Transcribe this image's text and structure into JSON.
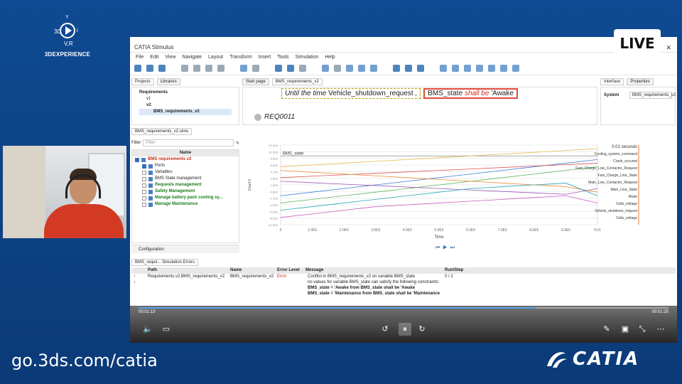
{
  "brand": {
    "name": "3DEXPERIENCE",
    "logo_text": "3D V,R"
  },
  "footer": {
    "url": "go.3ds.com/catia",
    "logo_word": "CATIA"
  },
  "live_badge": "LIVE",
  "app": {
    "title": "CATIA Stimulus",
    "menu": [
      "File",
      "Edit",
      "View",
      "Navigate",
      "Layout",
      "Transform",
      "Insert",
      "Tools",
      "Simulation",
      "Help"
    ]
  },
  "projects": {
    "tabs": [
      "Projects",
      "Libraries"
    ],
    "tree": [
      "Requirements",
      "v1",
      "v2",
      "BMS_requirements_v2"
    ]
  },
  "editor": {
    "tabs": [
      "Start page",
      "BMS_requirements_v2"
    ],
    "until_text": "Until the time",
    "until_var": "Vehicle_shutdown_request",
    "comma": ",",
    "state_var": "BMS_state",
    "shall_be": "shall be",
    "state_val": "'Awake",
    "req_id": "REQ0011"
  },
  "interface_panel": {
    "tabs": [
      "Interface",
      "Properties"
    ],
    "system_label": "System",
    "system_value": "BMS_requirements_v2"
  },
  "simulation": {
    "tab": "BMS_requirements_v2.simu",
    "filter_label": "Filter",
    "filter_placeholder": "Filter",
    "col_name": "Name",
    "rows": [
      {
        "label": "BMS requirements v2",
        "style": "redt"
      },
      {
        "label": "Ports",
        "style": ""
      },
      {
        "label": "Variables",
        "style": ""
      },
      {
        "label": "BMS State management",
        "style": ""
      },
      {
        "label": "Requests management",
        "style": "green"
      },
      {
        "label": "Safety Management",
        "style": "green"
      },
      {
        "label": "Manage battery pack cooling sy...",
        "style": "green"
      },
      {
        "label": "Manage Maintenance",
        "style": "green"
      }
    ],
    "configuration": "Configuration"
  },
  "chart_data": {
    "type": "line",
    "title": "",
    "xlabel": "Time",
    "ylabel": "Chart 0",
    "x_ticks": [
      "0",
      "1.0E5",
      "2.0E5",
      "3.0E5",
      "4.0E5",
      "5.0E5",
      "6.0E5",
      "7.0E5",
      "8.0E5",
      "9.0E5",
      "0.01"
    ],
    "time_readout": "0.01 seconds",
    "series": [
      {
        "name": "BMS_state",
        "values": [
          9,
          9,
          9,
          9,
          9,
          9,
          9,
          9,
          9,
          9,
          9
        ],
        "color": "#888888"
      },
      {
        "name": "Cooling_system_command",
        "values": [
          6,
          6.5,
          7,
          7.5,
          8,
          8.5,
          9,
          9.5,
          10,
          10.5,
          11
        ],
        "color": "#e8b84a"
      },
      {
        "name": "Crash_occured",
        "values": [
          -2,
          -1,
          0,
          1,
          2,
          3,
          4,
          5,
          6,
          7,
          8
        ],
        "color": "#3b7fd0"
      },
      {
        "name": "Fast_Charge_Low_Contactor_Request",
        "values": [
          3,
          3.4,
          3.8,
          4.2,
          4.6,
          5,
          5.4,
          5.8,
          6.2,
          6.6,
          7
        ],
        "color": "#d9534f"
      },
      {
        "name": "Fast_Charge_Line_State",
        "values": [
          -4,
          -3,
          -2,
          -1,
          0,
          1,
          2,
          3,
          4,
          5,
          6
        ],
        "color": "#5cb85c"
      },
      {
        "name": "Main_Line_Contactor_Request",
        "values": [
          2,
          1.6,
          1.2,
          0.8,
          0.4,
          0,
          -0.4,
          -0.8,
          -1.2,
          -1.6,
          0
        ],
        "color": "#9b59b6"
      },
      {
        "name": "Main_Line_State",
        "values": [
          5,
          4.5,
          4,
          3.5,
          3,
          2.5,
          2,
          1.5,
          1,
          0.5,
          -1
        ],
        "color": "#f08c3c"
      },
      {
        "name": "Cells_voltage",
        "values": [
          -6,
          -5,
          -4,
          -3,
          -2,
          -1,
          0,
          0.5,
          1,
          1.5,
          -2
        ],
        "color": "#2aa7b8"
      },
      {
        "name": "Vehicle_shutdown_request",
        "values": [
          -8,
          -7,
          -6,
          -5,
          -4.5,
          -4,
          -3.5,
          -3,
          -2.5,
          -2,
          -4
        ],
        "color": "#c45bbf"
      }
    ],
    "right_labels": [
      "Cooling_system_command",
      "Crash_occured",
      "Fast_Charge_Low_Contactor_Request",
      "Fast_Charge_Line_State",
      "Main_Line_Contactor_Request",
      "Main_Line_State",
      "Mode",
      "Cells_voltage",
      "Vehicle_shutdown_request",
      "Cells_voltage"
    ],
    "ylim": [
      -10,
      12
    ],
    "grid": true,
    "legend": "right"
  },
  "errors": {
    "tab": "BMS_requir... Simulation Errors",
    "headers": [
      "Path",
      "Name",
      "Error Level",
      "Message",
      "Run/Step"
    ],
    "row": {
      "path": "Requirements.v2.BMS_requirements_v2",
      "name": "BMS_requirements_v2",
      "level": "Error",
      "msg1": "Conflict in BMS_requirements_v2 on variable BMS_state",
      "msg2": "no values for variable BMS_state can satisfy the following constraints:",
      "msg3": "BMS_state = 'Awake from BMS_state shall be 'Awake",
      "msg4": "BMS_state = 'Maintenance from BMS_state shall be 'Maintenance",
      "run": "0 / 1"
    }
  },
  "player": {
    "elapsed": "00:01:13",
    "total": "00:01:25",
    "progress": 0.75
  }
}
